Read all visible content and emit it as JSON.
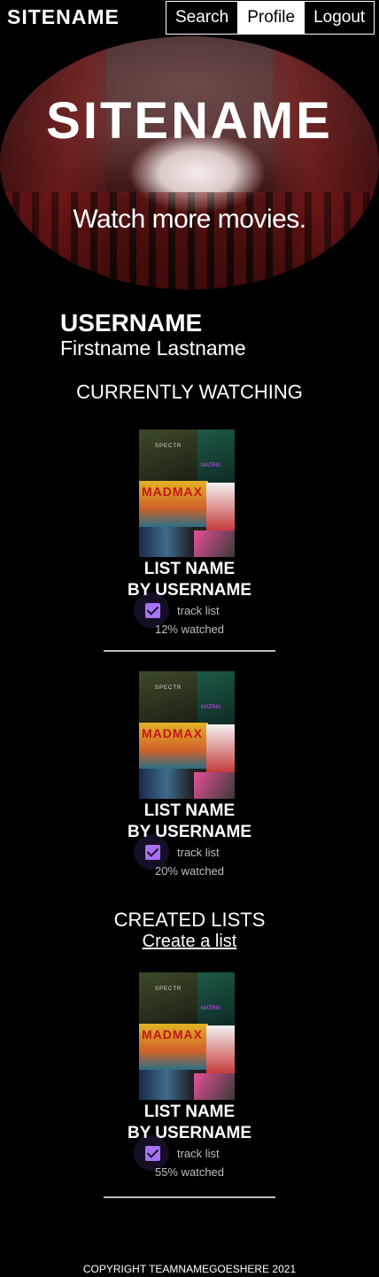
{
  "header": {
    "logo": "SITENAME",
    "nav": [
      "Search",
      "Profile",
      "Logout"
    ]
  },
  "hero": {
    "title": "SITENAME",
    "tagline": "Watch more movies."
  },
  "profile": {
    "username": "USERNAME",
    "fullname": "Firstname Lastname"
  },
  "currently_watching": {
    "title": "CURRENTLY WATCHING",
    "lists": [
      {
        "name": "LIST NAME",
        "by": "BY USERNAME",
        "track_label": "track list",
        "tracked": true,
        "watched_text": "12% watched",
        "watched_percent": 12
      },
      {
        "name": "LIST NAME",
        "by": "BY USERNAME",
        "track_label": "track list",
        "tracked": true,
        "watched_text": "20% watched",
        "watched_percent": 20
      }
    ]
  },
  "created_lists": {
    "title": "CREATED LISTS",
    "create_link": "Create a list",
    "lists": [
      {
        "name": "LIST NAME",
        "by": "BY USERNAME",
        "track_label": "track list",
        "tracked": true,
        "watched_text": "55% watched",
        "watched_percent": 55
      }
    ]
  },
  "poster_text": {
    "title_1": "MADMAX",
    "title_2": "SPECTR",
    "title_3": "MATRIX"
  },
  "footer": {
    "copyright": "COPYRIGHT TEAMNAMEGOESHERE 2021"
  },
  "colors": {
    "background": "#000000",
    "text": "#ffffff",
    "checkbox": "#a572f0",
    "muted": "#bdbdbd"
  }
}
